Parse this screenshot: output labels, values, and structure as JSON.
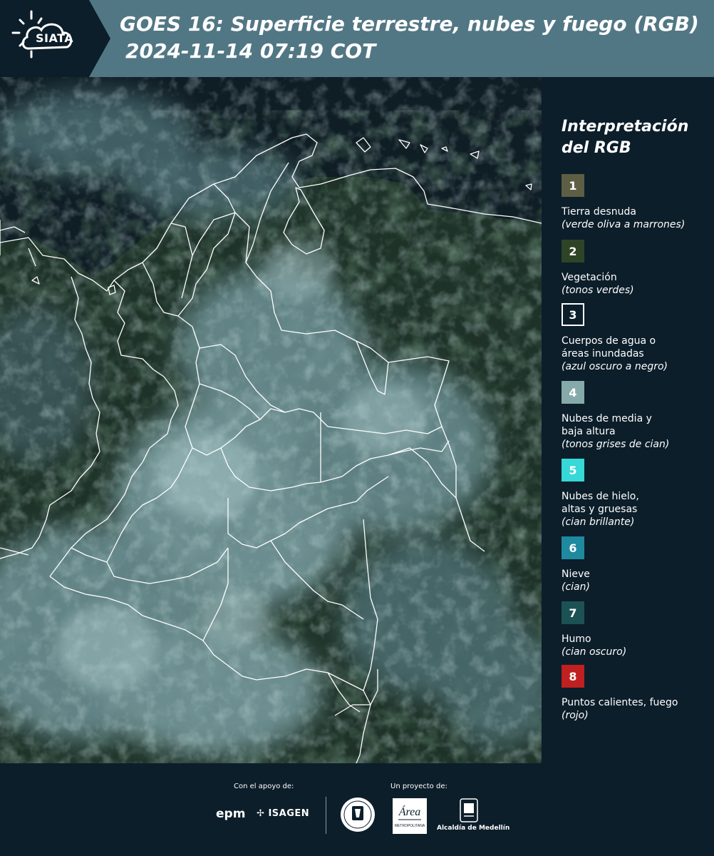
{
  "header": {
    "logo_text": "SIATA",
    "title": "GOES 16: Superficie terrestre, nubes y fuego (RGB)",
    "timestamp": " 2024-11-14 07:19 COT",
    "bg_color": "#527784"
  },
  "legend": {
    "title_line1": "Interpretación",
    "title_line2": "del RGB",
    "items": [
      {
        "number": "1",
        "label": "Tierra desnuda",
        "description": "(verde oliva a marrones)",
        "color": "#5e5e44"
      },
      {
        "number": "2",
        "label": "Vegetación",
        "description": "(tonos verdes)",
        "color": "#2e4426"
      },
      {
        "number": "3",
        "label": "Cuerpos de agua o áreas inundadas",
        "description": "(azul oscuro a negro)",
        "color": "#0c1e2a"
      },
      {
        "number": "4",
        "label": "Nubes de media y baja altura",
        "description": "(tonos grises de cian)",
        "color": "#86aaaa"
      },
      {
        "number": "5",
        "label": "Nubes de hielo, altas y gruesas",
        "description": "(cian brillante)",
        "color": "#36d8d8"
      },
      {
        "number": "6",
        "label": "Nieve",
        "description": "(cian)",
        "color": "#1e8aa0"
      },
      {
        "number": "7",
        "label": "Humo",
        "description": "(cian oscuro)",
        "color": "#1c5254"
      },
      {
        "number": "8",
        "label": "Puntos calientes, fuego",
        "description": "(rojo)",
        "color": "#c02020"
      }
    ]
  },
  "footer": {
    "support_label": "Con el apoyo de:",
    "project_label": "Un proyecto de:",
    "sponsors": [
      "epm",
      "ISAGEN"
    ],
    "partners": [
      "Alcaldía de Medellín"
    ],
    "amva_text": "Área",
    "amva_subtext": "METROPOLITANA"
  }
}
